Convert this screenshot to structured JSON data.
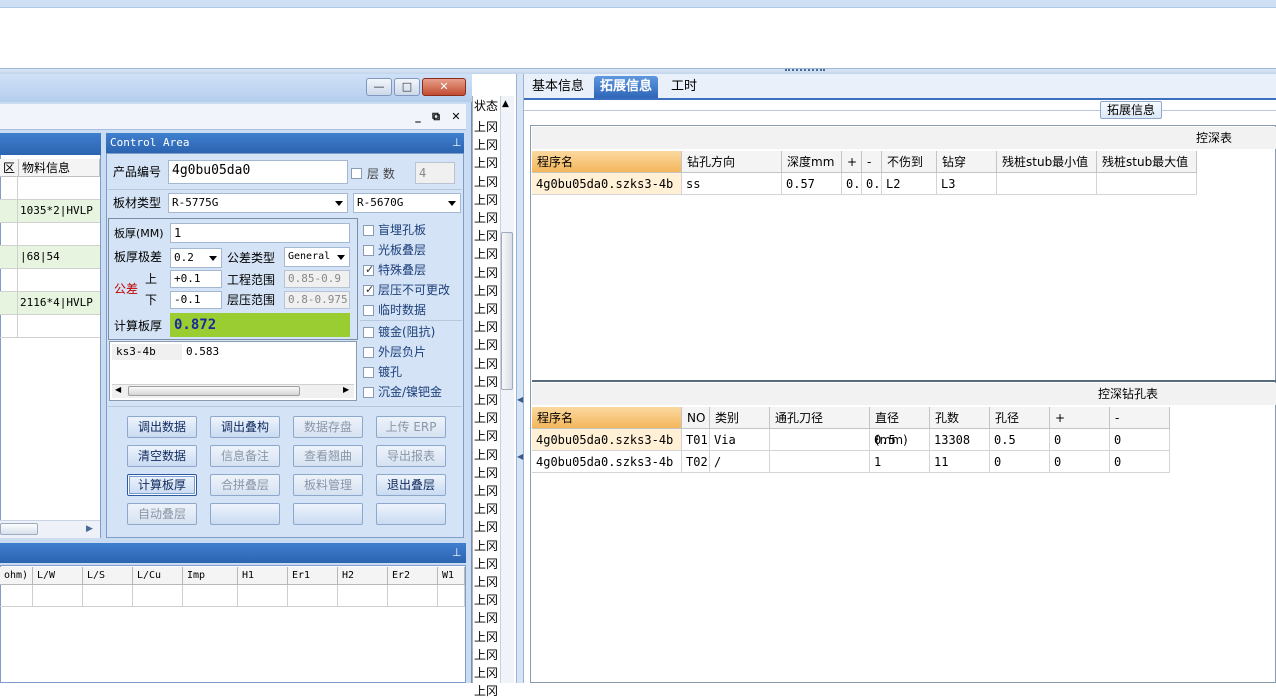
{
  "window": {
    "close": "✕",
    "min": "—",
    "max": "□"
  },
  "left_grid": {
    "headers": [
      "区",
      "物料信息"
    ],
    "rows": [
      {
        "material": ""
      },
      {
        "material": "1035*2|HVLP"
      },
      {
        "material": ""
      },
      {
        "material": "|68|54"
      },
      {
        "material": ""
      },
      {
        "material": "2116*4|HVLP"
      },
      {
        "material": ""
      }
    ]
  },
  "control": {
    "title": "Control Area",
    "product_label": "产品编号",
    "product_value": "4g0bu05da0",
    "layer_label": "层  数",
    "layer_value": "4",
    "board_type_label": "板材类型",
    "board_type_1": "R-5775G",
    "board_type_2": "R-5670G",
    "thickness_label": "板厚(MM)",
    "thickness_value": "1",
    "tol_level_label": "板厚极差",
    "tol_level_value": "0.2",
    "tol_type_label": "公差类型",
    "tol_type_value": "General",
    "tolerance_label": "公差",
    "upper_label": "上",
    "upper_value": "+0.1",
    "lower_label": "下",
    "lower_value": "-0.1",
    "eng_range_label": "工程范围",
    "eng_range_value": "0.85-0.9",
    "press_range_label": "层压范围",
    "press_range_value": "0.8-0.975",
    "calc_label": "计算板厚",
    "calc_value": "0.872",
    "list_row_name": "ks3-4b",
    "list_row_value": "0.583",
    "checkboxes": [
      {
        "label": "盲埋孔板",
        "checked": false
      },
      {
        "label": "光板叠层",
        "checked": false
      },
      {
        "label": "特殊叠层",
        "checked": true
      },
      {
        "label": "层压不可更改",
        "checked": true
      },
      {
        "label": "临时数据",
        "checked": false
      },
      {
        "label": "镀金(阻抗)",
        "checked": false
      },
      {
        "label": "外层负片",
        "checked": false
      },
      {
        "label": "镀孔",
        "checked": false
      },
      {
        "label": "沉金/镍钯金",
        "checked": false
      }
    ],
    "buttons": [
      [
        "调出数据",
        "调出叠构",
        "数据存盘",
        "上传 ERP"
      ],
      [
        "清空数据",
        "信息备注",
        "查看翘曲",
        "导出报表"
      ],
      [
        "计算板厚",
        "合拼叠层",
        "板料管理",
        "退出叠层"
      ],
      [
        "自动叠层",
        "",
        "",
        ""
      ]
    ]
  },
  "bottom_grid": {
    "headers": [
      "ohm)",
      "L/W",
      "L/S",
      "L/Cu",
      "Imp",
      "H1",
      "Er1",
      "H2",
      "Er2",
      "W1"
    ]
  },
  "middle": {
    "header": "状态",
    "cell": "上冈"
  },
  "tabs": [
    "基本信息",
    "拓展信息",
    "工时"
  ],
  "group_title": "拓展信息",
  "deep_table": {
    "title": "控深表",
    "headers": [
      "程序名",
      "钻孔方向",
      "深度mm",
      "+",
      "-",
      "不伤到",
      "钻穿",
      "残桩stub最小值",
      "残桩stub最大值"
    ],
    "rows": [
      [
        "4g0bu05da0.szks3-4b",
        "ss",
        "0.57",
        "0.",
        "0.",
        "L2",
        "L3",
        "",
        ""
      ]
    ]
  },
  "drill_table": {
    "title": "控深钻孔表",
    "headers": [
      "程序名",
      "NO",
      "类别",
      "通孔刀径",
      "直径(mm)",
      "孔数",
      "孔径",
      "+",
      "-"
    ],
    "rows": [
      [
        "4g0bu05da0.szks3-4b",
        "T01",
        "Via",
        "",
        "0.5",
        "13308",
        "0.5",
        "0",
        "0"
      ],
      [
        "4g0bu05da0.szks3-4b",
        "T02",
        "/",
        "",
        "1",
        "11",
        "0",
        "0",
        "0"
      ]
    ]
  }
}
